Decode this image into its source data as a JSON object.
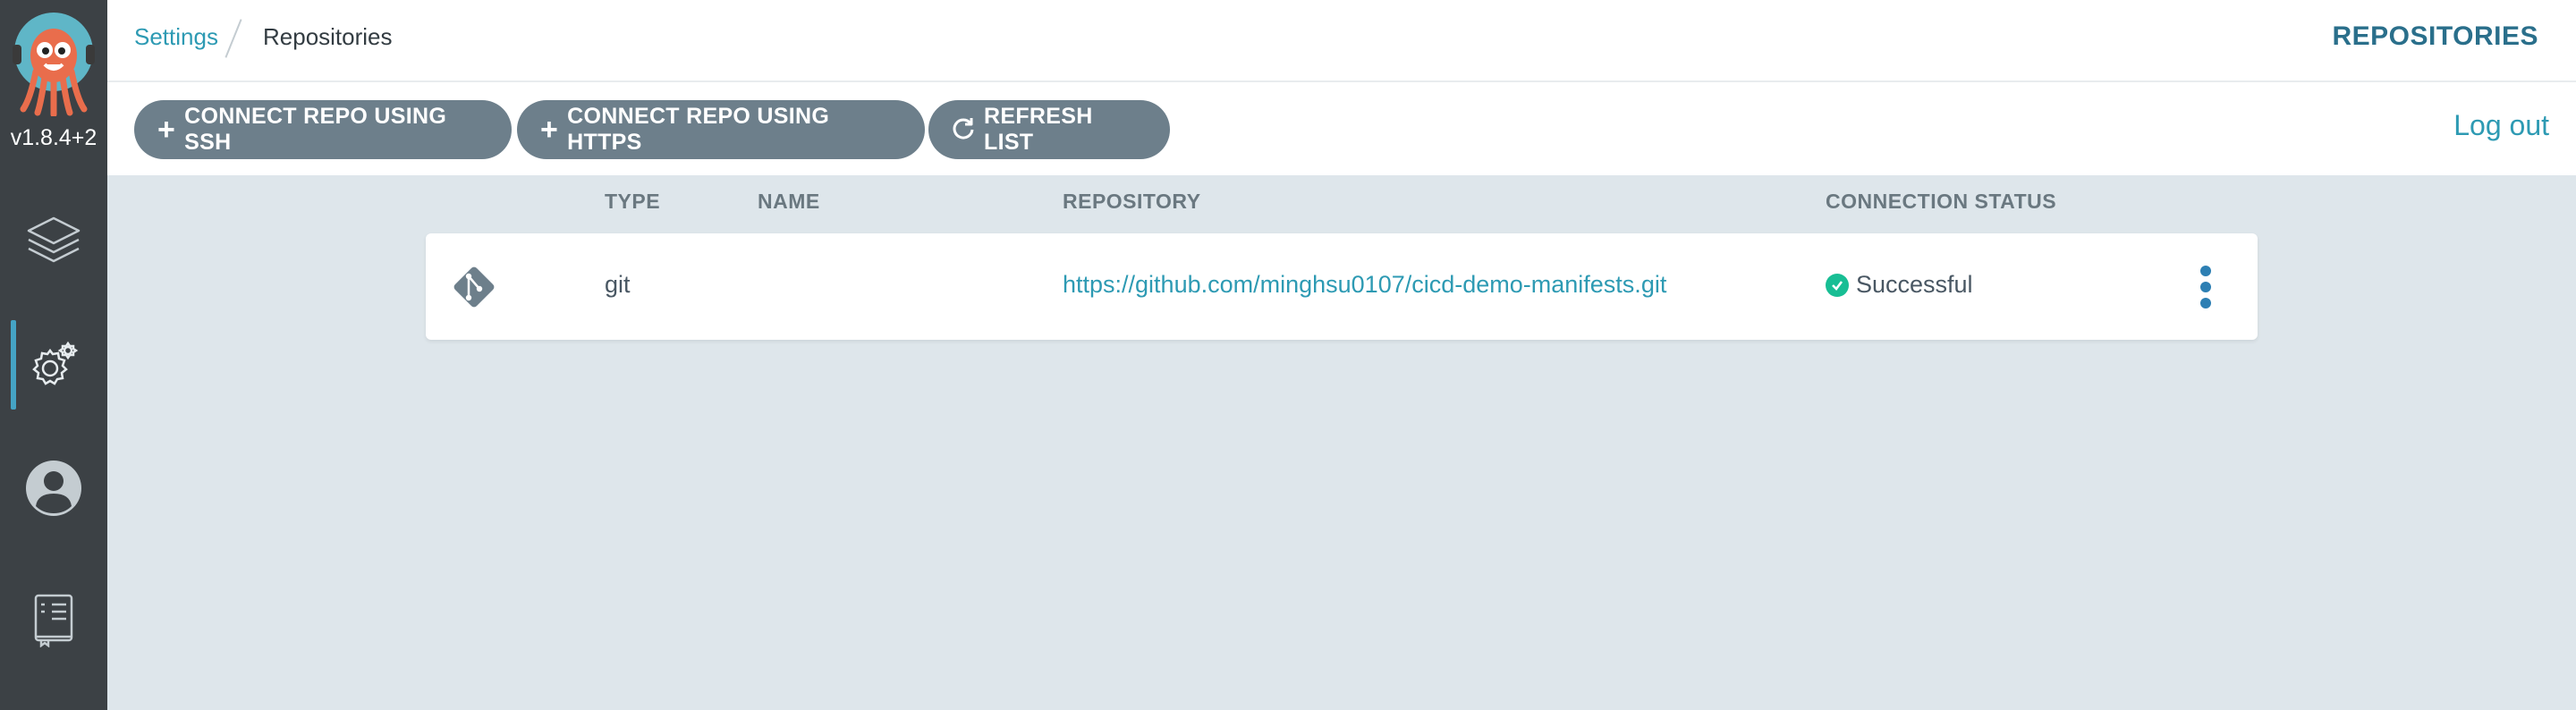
{
  "app": {
    "version": "v1.8.4+2",
    "logo_icon": "argo-octopus-logo"
  },
  "sidebar": {
    "items": [
      {
        "icon": "layers-icon",
        "label": "Applications"
      },
      {
        "icon": "gear-icon",
        "label": "Settings",
        "active": true
      },
      {
        "icon": "user-icon",
        "label": "User Info"
      },
      {
        "icon": "docs-icon",
        "label": "Documentation"
      }
    ]
  },
  "header": {
    "breadcrumb_parent": "Settings",
    "breadcrumb_current": "Repositories",
    "title": "REPOSITORIES"
  },
  "toolbar": {
    "connect_ssh_label": "CONNECT REPO USING SSH",
    "connect_https_label": "CONNECT REPO USING HTTPS",
    "refresh_label": "REFRESH LIST",
    "logout_label": "Log out"
  },
  "table": {
    "columns": [
      "TYPE",
      "NAME",
      "REPOSITORY",
      "CONNECTION STATUS"
    ],
    "rows": [
      {
        "icon": "git-icon",
        "type": "git",
        "name": "",
        "repository": "https://github.com/minghsu0107/cicd-demo-manifests.git",
        "status": "Successful",
        "status_color": "#18be94"
      }
    ]
  },
  "colors": {
    "accent": "#2d9ab3",
    "sidebar_bg": "#3c4145",
    "button_bg": "#6d7f8b",
    "page_bg": "#dee6eb",
    "success": "#18be94"
  }
}
